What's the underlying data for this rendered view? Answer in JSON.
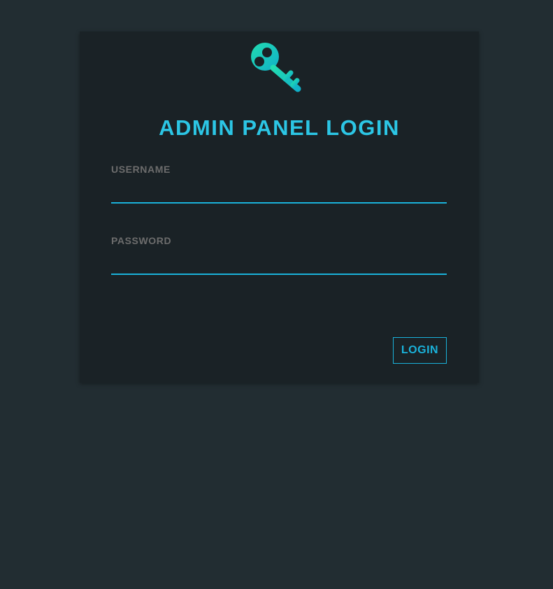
{
  "login_form": {
    "icon": "key-icon",
    "title": "ADMIN PANEL LOGIN",
    "username": {
      "label": "USERNAME",
      "value": "",
      "placeholder": ""
    },
    "password": {
      "label": "PASSWORD",
      "value": "",
      "placeholder": ""
    },
    "submit_label": "LOGIN"
  },
  "colors": {
    "page_background": "#222d32",
    "card_background": "#1a2226",
    "accent": "#1ab2da",
    "title": "#2cc6e5",
    "icon_gradient_start": "#1fd3b4",
    "icon_gradient_end": "#12b3c7",
    "label": "#6c6c6c"
  }
}
